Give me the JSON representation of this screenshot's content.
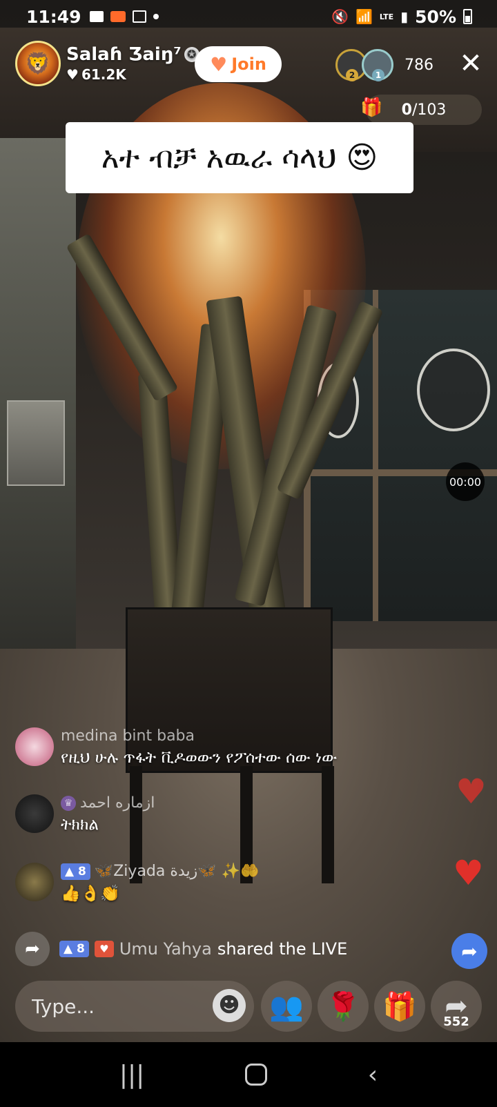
{
  "status_bar": {
    "time": "11:49",
    "battery_percent": "50%",
    "network": "LTE"
  },
  "host": {
    "name": "Salaɦ Ʒaiŋ⁷",
    "likes": "61.2K",
    "verified_icon": "✪"
  },
  "join_button": {
    "label": "Join"
  },
  "viewers": {
    "rank1": "2",
    "rank2": "1",
    "count": "786"
  },
  "goal": {
    "current": "0",
    "total": "/103"
  },
  "pinned_message": "አተ ብቻ አዉራ ሳላህ 😍",
  "timer": "00:00",
  "comments": [
    {
      "name": "medina bint baba",
      "text": "የዚህ ሁሉ ጥፋት ቪዶወውን የፖሰተው ሰው ነው"
    },
    {
      "name": "ازماره احمد",
      "text": "ትክክል"
    },
    {
      "level": "8",
      "name": "🦋Ziyada زيدة🦋 ✨🤲",
      "text": "👍👌👏"
    }
  ],
  "share_notice": {
    "level": "8",
    "user": "Umu Yahya",
    "action": "shared the LIVE"
  },
  "input": {
    "placeholder": "Type..."
  },
  "share_count": "552",
  "colors": {
    "accent": "#ff7a2a",
    "level_badge": "#5a7de0",
    "heart": "#e0302a"
  }
}
